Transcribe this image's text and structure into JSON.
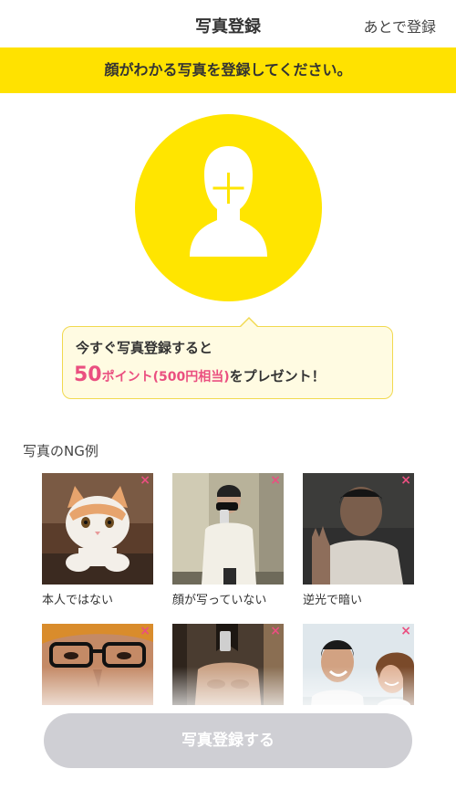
{
  "header": {
    "title": "写真登録",
    "later_label": "あとで登録"
  },
  "banner": {
    "text": "顔がわかる写真を登録してください。"
  },
  "avatar": {
    "icon": "person-plus-icon",
    "bg_color": "#ffe500"
  },
  "promo": {
    "line1": "今すぐ写真登録すると",
    "points_number": "50",
    "points_unit": "ポイント(500円相当)",
    "line2_rest": "をプレゼント！",
    "accent_color": "#ea4f80"
  },
  "ng_section": {
    "title": "写真のNG例",
    "mark": "×",
    "items": [
      {
        "caption": "本人ではない"
      },
      {
        "caption": "顔が写っていない"
      },
      {
        "caption": "逆光で暗い"
      },
      {
        "caption": ""
      },
      {
        "caption": ""
      },
      {
        "caption": ""
      }
    ]
  },
  "footer": {
    "submit_label": "写真登録する",
    "button_color": "#cfcfd4"
  }
}
